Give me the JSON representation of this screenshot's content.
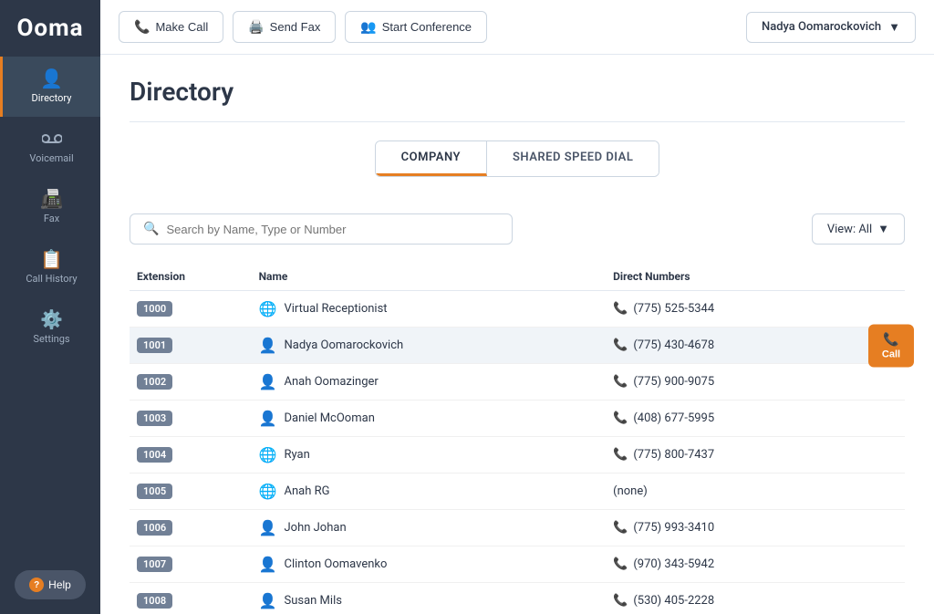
{
  "app": {
    "logo": "Ooma"
  },
  "sidebar": {
    "items": [
      {
        "id": "directory",
        "label": "Directory",
        "icon": "👤",
        "active": true
      },
      {
        "id": "voicemail",
        "label": "Voicemail",
        "icon": "🔊",
        "active": false
      },
      {
        "id": "fax",
        "label": "Fax",
        "icon": "📠",
        "active": false
      },
      {
        "id": "call-history",
        "label": "Call History",
        "icon": "📋",
        "active": false
      },
      {
        "id": "settings",
        "label": "Settings",
        "icon": "⚙️",
        "active": false
      }
    ],
    "help_label": "Help"
  },
  "topbar": {
    "make_call_label": "Make Call",
    "send_fax_label": "Send Fax",
    "start_conference_label": "Start Conference",
    "user_name": "Nadya Oomarockovich",
    "dropdown_arrow": "▼"
  },
  "page": {
    "title": "Directory",
    "tabs": [
      {
        "id": "company",
        "label": "COMPANY",
        "active": true
      },
      {
        "id": "shared-speed-dial",
        "label": "SHARED SPEED DIAL",
        "active": false
      }
    ],
    "search": {
      "placeholder": "Search by Name, Type or Number"
    },
    "view_label": "View: All",
    "table": {
      "headers": [
        "Extension",
        "Name",
        "Direct Numbers",
        ""
      ],
      "rows": [
        {
          "ext": "1000",
          "icon": "🌐",
          "name": "Virtual Receptionist",
          "phone": "(775) 525-5344",
          "highlighted": false,
          "show_call": false
        },
        {
          "ext": "1001",
          "icon": "👤",
          "name": "Nadya Oomarockovich",
          "phone": "(775) 430-4678",
          "highlighted": true,
          "show_call": true
        },
        {
          "ext": "1002",
          "icon": "👤",
          "name": "Anah Oomazinger",
          "phone": "(775) 900-9075",
          "highlighted": false,
          "show_call": false
        },
        {
          "ext": "1003",
          "icon": "👤",
          "name": "Daniel McOoman",
          "phone": "(408) 677-5995",
          "highlighted": false,
          "show_call": false
        },
        {
          "ext": "1004",
          "icon": "🌐",
          "name": "Ryan",
          "phone": "(775) 800-7437",
          "highlighted": false,
          "show_call": false
        },
        {
          "ext": "1005",
          "icon": "🌐",
          "name": "Anah RG",
          "phone": "(none)",
          "highlighted": false,
          "show_call": false
        },
        {
          "ext": "1006",
          "icon": "👤",
          "name": "John Johan",
          "phone": "(775) 993-3410",
          "highlighted": false,
          "show_call": false
        },
        {
          "ext": "1007",
          "icon": "👤",
          "name": "Clinton Oomavenko",
          "phone": "(970) 343-5942",
          "highlighted": false,
          "show_call": false
        },
        {
          "ext": "1008",
          "icon": "👤",
          "name": "Susan Mils",
          "phone": "(530) 405-2228",
          "highlighted": false,
          "show_call": false
        }
      ]
    }
  },
  "call_button_label": "Call"
}
